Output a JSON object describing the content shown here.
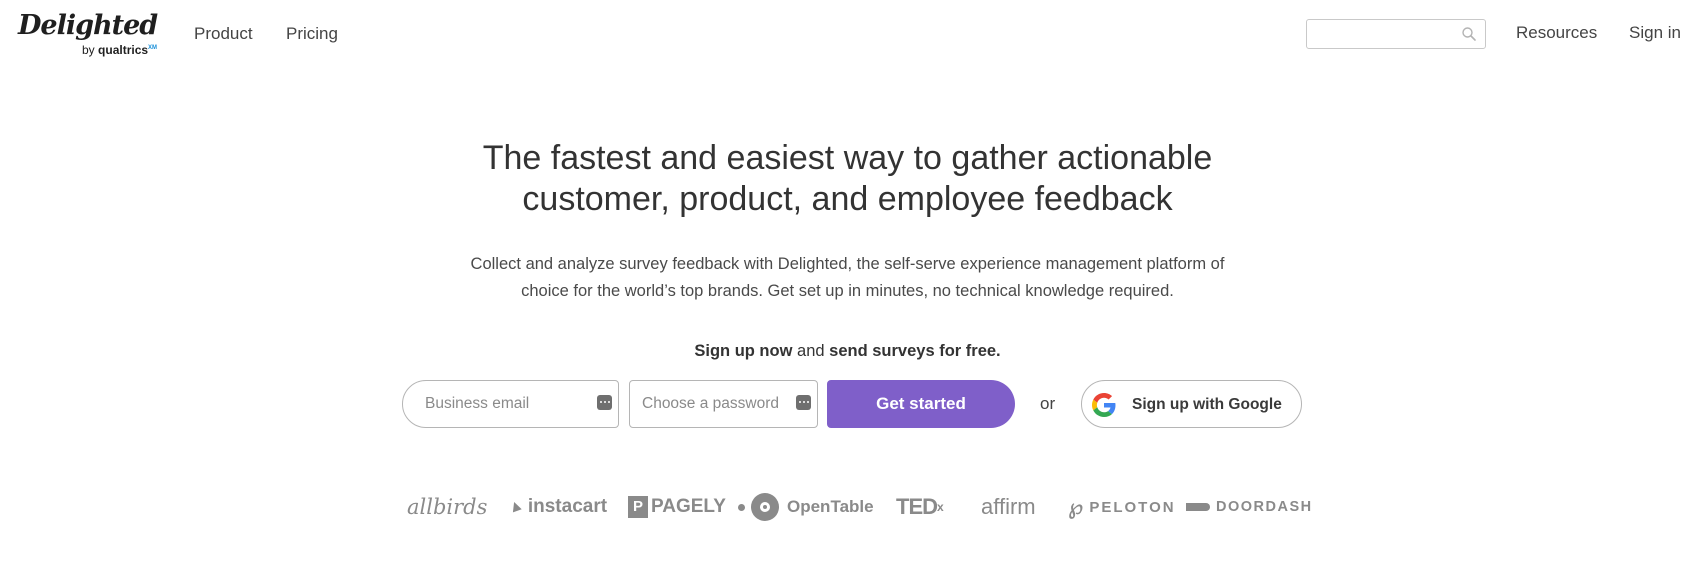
{
  "header": {
    "logo": {
      "wordmark": "Delighted",
      "by": "by",
      "brand": "qualtrics",
      "brand_mark": "XM"
    },
    "nav": {
      "product": "Product",
      "pricing": "Pricing",
      "resources": "Resources",
      "sign_in": "Sign in"
    },
    "search": {
      "placeholder": "",
      "icon": "search-icon"
    }
  },
  "hero": {
    "title_line1": "The fastest and easiest way to gather actionable",
    "title_line2": "customer, product, and employee feedback",
    "subtitle_line1": "Collect and analyze survey feedback with Delighted, the self-serve experience management platform of",
    "subtitle_line2": "choice for the world’s top brands. Get set up in minutes, no technical knowledge required."
  },
  "signup": {
    "tagline_part1": "Sign up now",
    "tagline_part2": " and ",
    "tagline_part3": "send surveys for free.",
    "email_placeholder": "Business email",
    "password_placeholder": "Choose a password",
    "get_started_label": "Get started",
    "or_label": "or",
    "google_label": "Sign up with Google",
    "button_color": "#7f5fc9"
  },
  "customers": {
    "allbirds": "allbirds",
    "instacart": "instacart",
    "pagely": "PAGELY",
    "pagely_mark": "P",
    "opentable": "OpenTable",
    "opentable_mark": "·",
    "ted": "TED",
    "ted_sup": "x",
    "affirm": "affirm",
    "peloton": "PELOTON",
    "doordash": "DOORDASH"
  }
}
